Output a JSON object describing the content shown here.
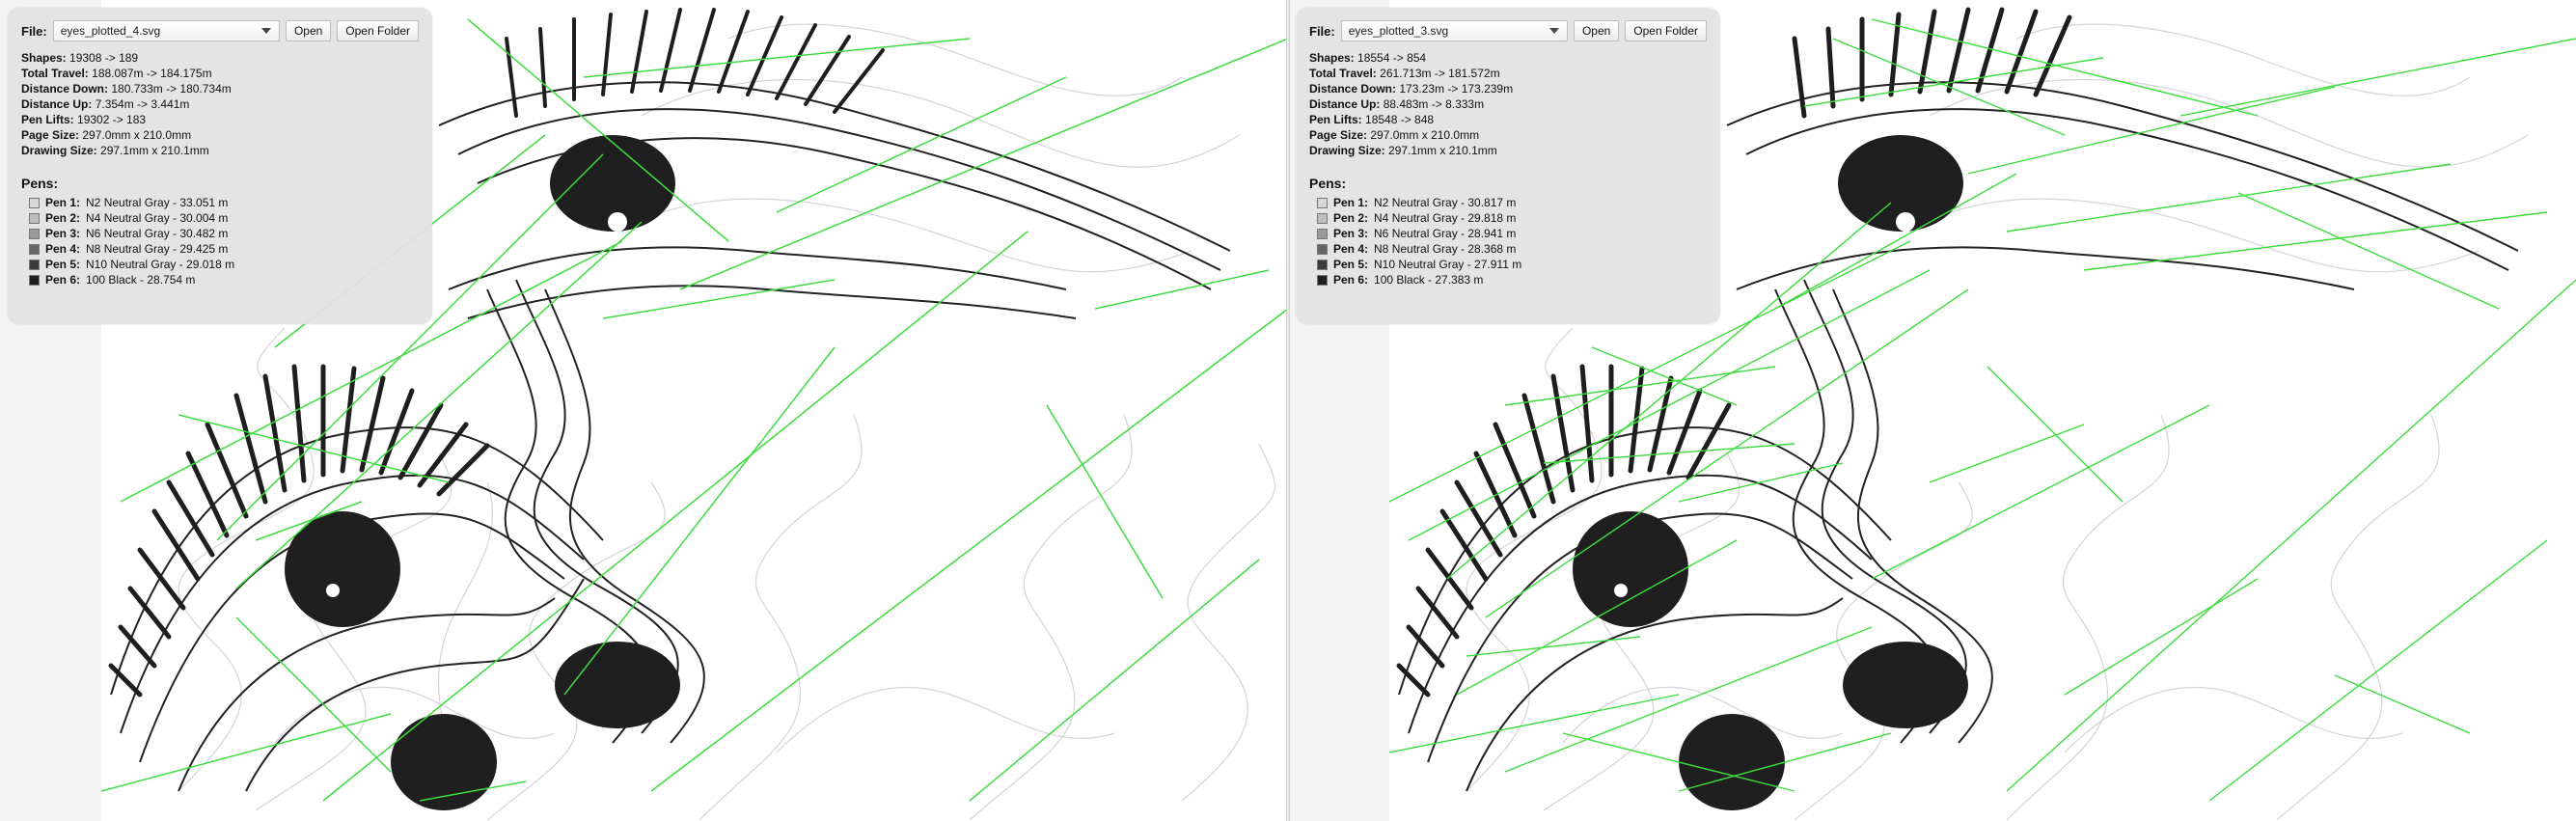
{
  "colors": {
    "travel_line": "#3ddc3d",
    "stroke_dark": "#222222",
    "stroke_light": "#cfcfd6",
    "panel_bg": "#e3e3e3"
  },
  "panes": [
    {
      "file_label": "File:",
      "file_value": "eyes_plotted_4.svg",
      "open_label": "Open",
      "open_folder_label": "Open Folder",
      "stats": [
        {
          "key": "Shapes:",
          "value": "19308 -> 189"
        },
        {
          "key": "Total Travel:",
          "value": "188.087m -> 184.175m"
        },
        {
          "key": "Distance Down:",
          "value": "180.733m -> 180.734m"
        },
        {
          "key": "Distance Up:",
          "value": "7.354m -> 3.441m"
        },
        {
          "key": "Pen Lifts:",
          "value": "19302 -> 183"
        },
        {
          "key": "Page Size:",
          "value": "297.0mm x 210.0mm"
        },
        {
          "key": "Drawing Size:",
          "value": "297.1mm x 210.1mm"
        }
      ],
      "pens_title": "Pens:",
      "pens": [
        {
          "label": "Pen 1:",
          "value": "N2 Neutral Gray - 33.051 m",
          "color": "#d8d8d8"
        },
        {
          "label": "Pen 2:",
          "value": "N4 Neutral Gray - 30.004 m",
          "color": "#bdbdbd"
        },
        {
          "label": "Pen 3:",
          "value": "N6 Neutral Gray - 30.482 m",
          "color": "#9a9a9a"
        },
        {
          "label": "Pen 4:",
          "value": "N8 Neutral Gray - 29.425 m",
          "color": "#666666"
        },
        {
          "label": "Pen 5:",
          "value": "N10 Neutral Gray - 29.018 m",
          "color": "#3b3b3b"
        },
        {
          "label": "Pen 6:",
          "value": "100 Black - 28.754 m",
          "color": "#1e1e1e"
        }
      ]
    },
    {
      "file_label": "File:",
      "file_value": "eyes_plotted_3.svg",
      "open_label": "Open",
      "open_folder_label": "Open Folder",
      "stats": [
        {
          "key": "Shapes:",
          "value": "18554 -> 854"
        },
        {
          "key": "Total Travel:",
          "value": "261.713m -> 181.572m"
        },
        {
          "key": "Distance Down:",
          "value": "173.23m -> 173.239m"
        },
        {
          "key": "Distance Up:",
          "value": "88.483m -> 8.333m"
        },
        {
          "key": "Pen Lifts:",
          "value": "18548 -> 848"
        },
        {
          "key": "Page Size:",
          "value": "297.0mm x 210.0mm"
        },
        {
          "key": "Drawing Size:",
          "value": "297.1mm x 210.1mm"
        }
      ],
      "pens_title": "Pens:",
      "pens": [
        {
          "label": "Pen 1:",
          "value": "N2 Neutral Gray - 30.817 m",
          "color": "#d8d8d8"
        },
        {
          "label": "Pen 2:",
          "value": "N4 Neutral Gray - 29.818 m",
          "color": "#bdbdbd"
        },
        {
          "label": "Pen 3:",
          "value": "N6 Neutral Gray - 28.941 m",
          "color": "#9a9a9a"
        },
        {
          "label": "Pen 4:",
          "value": "N8 Neutral Gray - 28.368 m",
          "color": "#666666"
        },
        {
          "label": "Pen 5:",
          "value": "N10 Neutral Gray - 27.911 m",
          "color": "#3b3b3b"
        },
        {
          "label": "Pen 6:",
          "value": "100 Black - 27.383 m",
          "color": "#1e1e1e"
        }
      ]
    }
  ]
}
